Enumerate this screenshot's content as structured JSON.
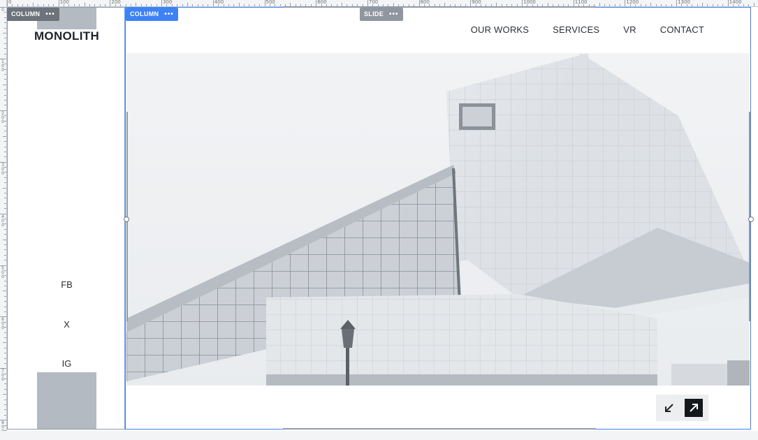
{
  "ruler": {
    "top_labels": [
      "0",
      "100",
      "200",
      "300",
      "400",
      "500",
      "600",
      "700",
      "800",
      "900",
      "1000",
      "1100",
      "1200",
      "1300",
      "1400"
    ],
    "left_labels": [
      "0",
      "100",
      "200",
      "300",
      "400",
      "500",
      "600",
      "700",
      "800"
    ]
  },
  "badges": {
    "left_column": "COLUMN",
    "main_column": "COLUMN",
    "slide": "SLIDE",
    "more_glyph": "•••"
  },
  "sidebar": {
    "logo": "MONOLITH",
    "social": [
      "FB",
      "X",
      "IG"
    ]
  },
  "nav": {
    "items": [
      "OUR WORKS",
      "SERVICES",
      "VR",
      "CONTACT"
    ]
  },
  "hero": {
    "image_icon": "architecture-photo",
    "colors": {
      "sky": "#eef0f2",
      "structure": "#dfe2e6",
      "glass": "#c3c8cf",
      "frame": "#8b9098"
    }
  },
  "slider_controls": {
    "prev_icon": "arrow-down-left-icon",
    "next_icon": "arrow-up-right-icon"
  },
  "colors": {
    "selection_blue": "#3d82f5",
    "badge_grey": "#6d737a",
    "placeholder_grey": "#b4bac2"
  }
}
